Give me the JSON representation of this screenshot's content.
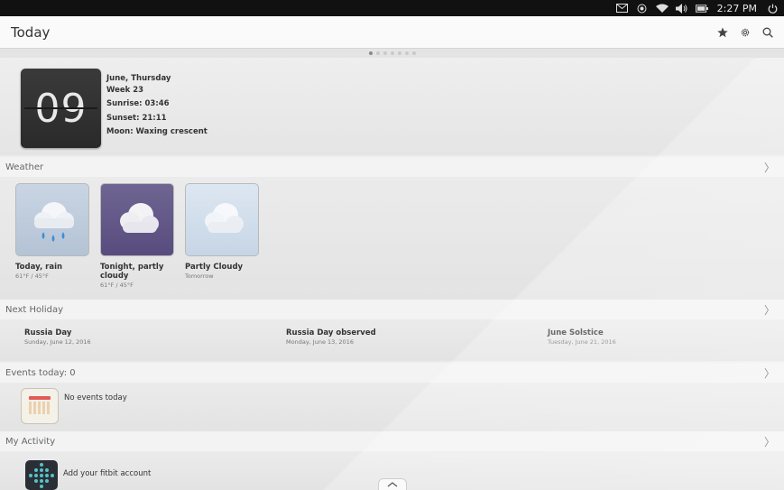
{
  "status": {
    "time": "2:27 PM",
    "icons": [
      "mail-icon",
      "location-icon",
      "wifi-icon",
      "volume-icon",
      "battery-icon",
      "power-icon"
    ]
  },
  "header": {
    "title": "Today",
    "actions": [
      "star-icon",
      "gear-icon",
      "search-icon"
    ]
  },
  "pager": {
    "count": 7,
    "active": 0
  },
  "date": {
    "day": "09",
    "lines": [
      "June, Thursday",
      "Week 23",
      "Sunrise: 03:46",
      "Sunset: 21:11",
      "Moon: Waxing crescent"
    ]
  },
  "weather": {
    "title": "Weather",
    "cards": [
      {
        "label": "Today, rain",
        "sub": "61°F / 45°F",
        "icon": "rain-cloud-icon"
      },
      {
        "label": "Tonight, partly cloudy",
        "sub": "61°F / 45°F",
        "icon": "cloud-icon"
      },
      {
        "label": "Partly Cloudy",
        "sub": "Tomorrow",
        "icon": "cloud-icon"
      }
    ]
  },
  "holiday": {
    "title": "Next Holiday",
    "items": [
      {
        "name": "Russia Day",
        "date": "Sunday, June 12, 2016"
      },
      {
        "name": "Russia Day observed",
        "date": "Monday, June 13, 2016"
      },
      {
        "name": "June Solstice",
        "date": "Tuesday, June 21, 2016"
      }
    ]
  },
  "events": {
    "title": "Events today: 0",
    "empty": "No events today"
  },
  "activity": {
    "title": "My Activity",
    "action": "Add your fitbit account"
  },
  "colors": {
    "accent_night": "#584c7e",
    "status_bar": "#111111"
  }
}
